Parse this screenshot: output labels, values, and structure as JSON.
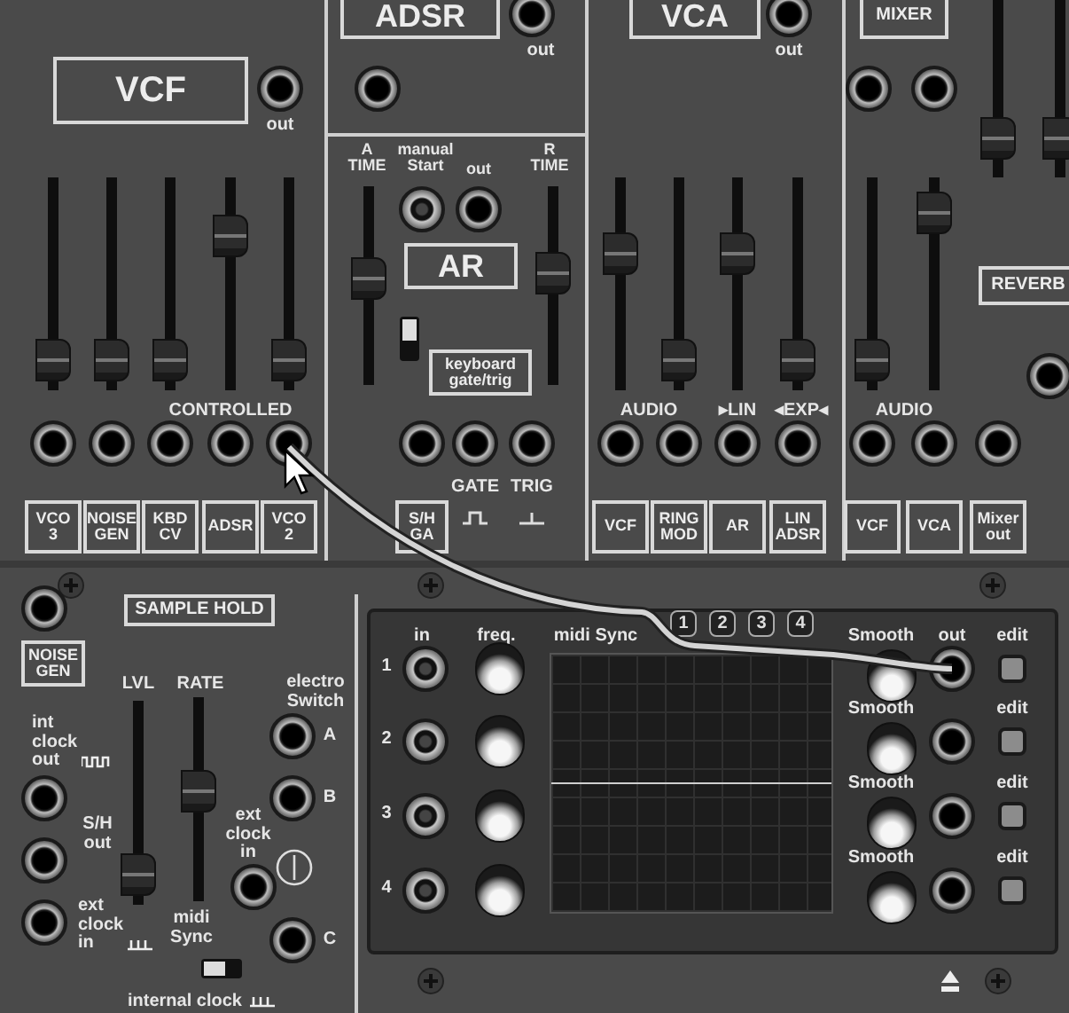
{
  "vcf": {
    "title": "VCF",
    "out_label": "out",
    "group_label": "CONTROLLED",
    "sliders": [
      {
        "level": 0.05
      },
      {
        "level": 0.05
      },
      {
        "level": 0.05
      },
      {
        "level": 0.78
      },
      {
        "level": 0.05
      }
    ],
    "sources": [
      "VCO\n3",
      "NOISE\nGEN",
      "KBD\nCV",
      "ADSR",
      "VCO\n2"
    ]
  },
  "adsr": {
    "title": "ADSR",
    "out_label": "out"
  },
  "ar": {
    "title": "AR",
    "a_label": "A\nTIME",
    "start_label": "manual\nStart",
    "out_label": "out",
    "r_label": "R\nTIME",
    "a_slider": {
      "level": 0.55
    },
    "r_slider": {
      "level": 0.58
    },
    "keyboard_label": "keyboard\ngate/trig",
    "gate_label": "GATE",
    "trig_label": "TRIG",
    "source": "S/H\nGA"
  },
  "vca": {
    "title": "VCA",
    "out_label": "out",
    "audio_label": "AUDIO",
    "lin_label": "▸LIN",
    "exp_label": "◂EXP◂",
    "sliders": [
      {
        "level": 0.68
      },
      {
        "level": 0.05
      },
      {
        "level": 0.68
      },
      {
        "level": 0.05
      }
    ],
    "sources": [
      "VCF",
      "RING\nMOD",
      "AR",
      "LIN\nADSR"
    ]
  },
  "mixer": {
    "title": "MIXER",
    "reverb": "REVERB",
    "audio_label": "AUDIO",
    "sliders": [
      {
        "level": 0.05
      },
      {
        "level": 0.92
      },
      {
        "level": 0.12
      },
      {
        "level": 0.12
      }
    ],
    "sources": [
      "VCF",
      "VCA",
      "Mixer\nout"
    ]
  },
  "sample_hold": {
    "title": "SAMPLE HOLD",
    "source": "NOISE\nGEN",
    "lvl_label": "LVL",
    "rate_label": "RATE",
    "lvl": {
      "level": 0.05
    },
    "rate": {
      "level": 0.55
    },
    "int_clock": "int\nclock\nout",
    "sh_out": "S/H\nout",
    "ext_clock": "ext\nclock\nin",
    "midi_sync": "midi\nSync",
    "internal_clock": "internal clock"
  },
  "electro_switch": {
    "title": "electro\nSwitch",
    "ports": [
      "A",
      "B",
      "C"
    ],
    "ext_clock": "ext\nclock\nin"
  },
  "sequencer": {
    "in_label": "in",
    "freq_label": "freq.",
    "sync_label": "midi Sync",
    "patterns": [
      "1",
      "2",
      "3",
      "4"
    ],
    "out_label": "out",
    "rows": [
      {
        "number": "1",
        "smooth": "Smooth",
        "edit": "edit"
      },
      {
        "number": "2",
        "smooth": "Smooth",
        "edit": "edit"
      },
      {
        "number": "3",
        "smooth": "Smooth",
        "edit": "edit"
      },
      {
        "number": "4",
        "smooth": "Smooth",
        "edit": "edit"
      }
    ]
  }
}
